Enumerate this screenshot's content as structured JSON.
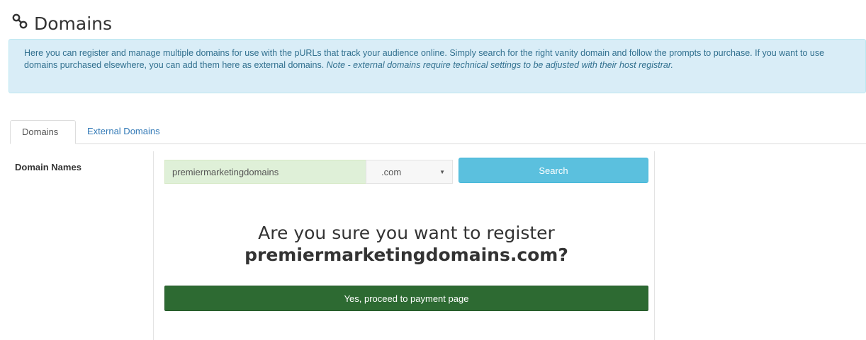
{
  "page": {
    "title": "Domains",
    "icon": "link-icon"
  },
  "info": {
    "text": "Here you can register and manage multiple domains for use with the pURLs that track your audience online. Simply search for the right vanity domain and follow the prompts to purchase. If you want to use domains purchased elsewhere, you can add them here as external domains. ",
    "note": "Note - external domains require technical settings to be adjusted with their host registrar."
  },
  "tabs": [
    {
      "label": "Domains",
      "active": true
    },
    {
      "label": "External Domains",
      "active": false
    }
  ],
  "section": {
    "label": "Domain Names"
  },
  "search": {
    "value": "premiermarketingdomains",
    "tld": ".com",
    "button_label": "Search"
  },
  "confirm": {
    "question": "Are you sure you want to register",
    "domain": "premiermarketingdomains.com?",
    "button_label": "Yes, proceed to payment page"
  },
  "colors": {
    "info_bg": "#d9edf7",
    "search_button": "#5bc0de",
    "proceed_button": "#2d6a32",
    "input_bg": "#dff0d8",
    "tab_link": "#337ab7"
  }
}
